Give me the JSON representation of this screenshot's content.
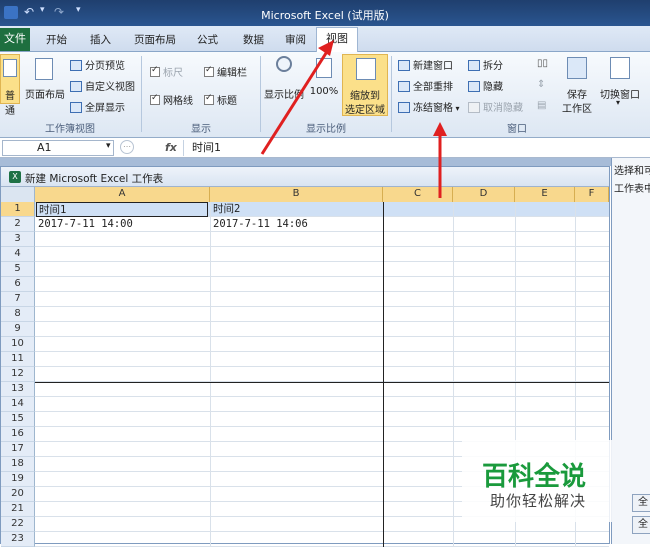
{
  "app": {
    "title": "Microsoft Excel (试用版)"
  },
  "tabs": {
    "file": "文件",
    "items": [
      "开始",
      "插入",
      "页面布局",
      "公式",
      "数据",
      "审阅"
    ],
    "active": "视图"
  },
  "ribbon": {
    "workbook_views": {
      "normal_partial": "普通",
      "page_layout": "页面布局",
      "page_break_preview": "分页预览",
      "custom_views": "自定义视图",
      "full_screen": "全屏显示",
      "group_label": "工作簿视图"
    },
    "show": {
      "ruler": "标尺",
      "ruler_checked": true,
      "ruler_disabled": true,
      "formula_bar": "编辑栏",
      "formula_bar_checked": true,
      "gridlines": "网格线",
      "gridlines_checked": true,
      "headings": "标题",
      "headings_checked": true,
      "group_label": "显示"
    },
    "zoom": {
      "zoom": "显示比例",
      "hundred": "100%",
      "zoom_to_selection_line1": "缩放到",
      "zoom_to_selection_line2": "选定区域",
      "group_label": "显示比例"
    },
    "window": {
      "new_window": "新建窗口",
      "arrange_all": "全部重排",
      "freeze_panes": "冻结窗格",
      "split": "拆分",
      "hide": "隐藏",
      "unhide": "取消隐藏",
      "save_workspace_line1": "保存",
      "save_workspace_line2": "工作区",
      "switch_windows": "切换窗口",
      "group_label": "窗口"
    }
  },
  "formula_bar": {
    "name_box": "A1",
    "fx": "fx",
    "value": "时间1"
  },
  "workbook": {
    "title": "新建 Microsoft Excel 工作表",
    "columns": [
      "A",
      "B",
      "C",
      "D",
      "E",
      "F"
    ],
    "rows": [
      "1",
      "2",
      "3",
      "4",
      "5",
      "6",
      "7",
      "8",
      "9",
      "10",
      "11",
      "12",
      "13",
      "14",
      "15",
      "16",
      "17",
      "18",
      "19",
      "20",
      "21",
      "22",
      "23"
    ],
    "cells": {
      "a1": "时间1",
      "b1": "时间2",
      "a2": "2017-7-11 14:00",
      "b2": "2017-7-11 14:06"
    }
  },
  "right_pane": {
    "title_partial": "选择和可",
    "label_partial": "工作表中",
    "button1": "全",
    "button2": "全"
  },
  "watermark": {
    "brand": "百科全说",
    "slogan": "助你轻松解决"
  },
  "colors": {
    "file_tab": "#1e6f3f",
    "selection_header": "#f8d88d",
    "annotation_arrow": "#e02020",
    "watermark": "#1a9a3c"
  }
}
